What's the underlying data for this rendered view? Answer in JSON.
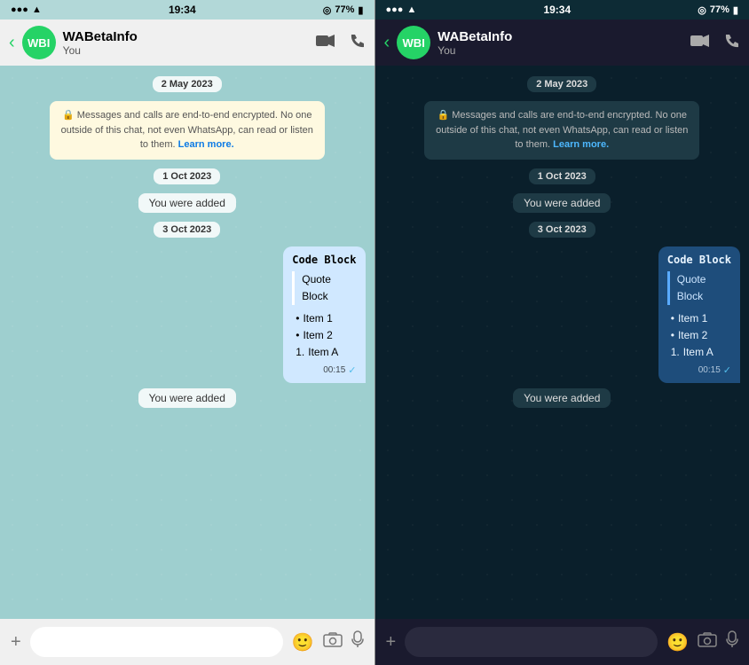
{
  "left": {
    "theme": "light",
    "statusBar": {
      "time": "19:34",
      "battery": "77%",
      "batteryIcon": "🔋"
    },
    "header": {
      "backLabel": "‹",
      "avatarText": "WBI",
      "name": "WABetaInfo",
      "sub": "You",
      "videoIcon": "📹",
      "callIcon": "📞"
    },
    "messages": [
      {
        "type": "date",
        "text": "2 May 2023"
      },
      {
        "type": "encryption",
        "text": "🔒 Messages and calls are end-to-end encrypted. No one outside of this chat, not even WhatsApp, can read or listen to them.",
        "learnMore": "Learn more."
      },
      {
        "type": "date",
        "text": "1 Oct 2023"
      },
      {
        "type": "system",
        "text": "You were added"
      },
      {
        "type": "date",
        "text": "3 Oct 2023"
      },
      {
        "type": "sent",
        "codeBlock": "Code Block",
        "quoteLines": [
          "Quote",
          "Block"
        ],
        "bulletItems": [
          "Item 1",
          "Item 2"
        ],
        "numberedItems": [
          "Item A"
        ],
        "time": "00:15",
        "check": "✓"
      },
      {
        "type": "system",
        "text": "You were added"
      }
    ],
    "bottomBar": {
      "plusLabel": "+",
      "stickerIcon": "🙂",
      "cameraIcon": "📷",
      "micIcon": "🎙"
    }
  },
  "right": {
    "theme": "dark",
    "statusBar": {
      "time": "19:34",
      "battery": "77%",
      "batteryIcon": "🔋"
    },
    "header": {
      "backLabel": "‹",
      "avatarText": "WBI",
      "name": "WABetaInfo",
      "sub": "You",
      "videoIcon": "📹",
      "callIcon": "📞"
    },
    "messages": [
      {
        "type": "date",
        "text": "2 May 2023"
      },
      {
        "type": "encryption",
        "text": "🔒 Messages and calls are end-to-end encrypted. No one outside of this chat, not even WhatsApp, can read or listen to them.",
        "learnMore": "Learn more."
      },
      {
        "type": "date",
        "text": "1 Oct 2023"
      },
      {
        "type": "system",
        "text": "You were added"
      },
      {
        "type": "date",
        "text": "3 Oct 2023"
      },
      {
        "type": "sent",
        "codeBlock": "Code Block",
        "quoteLines": [
          "Quote",
          "Block"
        ],
        "bulletItems": [
          "Item 1",
          "Item 2"
        ],
        "numberedItems": [
          "Item A"
        ],
        "time": "00:15",
        "check": "✓"
      },
      {
        "type": "system",
        "text": "You were added"
      }
    ],
    "bottomBar": {
      "plusLabel": "+",
      "stickerIcon": "🙂",
      "cameraIcon": "📷",
      "micIcon": "🎙"
    }
  }
}
